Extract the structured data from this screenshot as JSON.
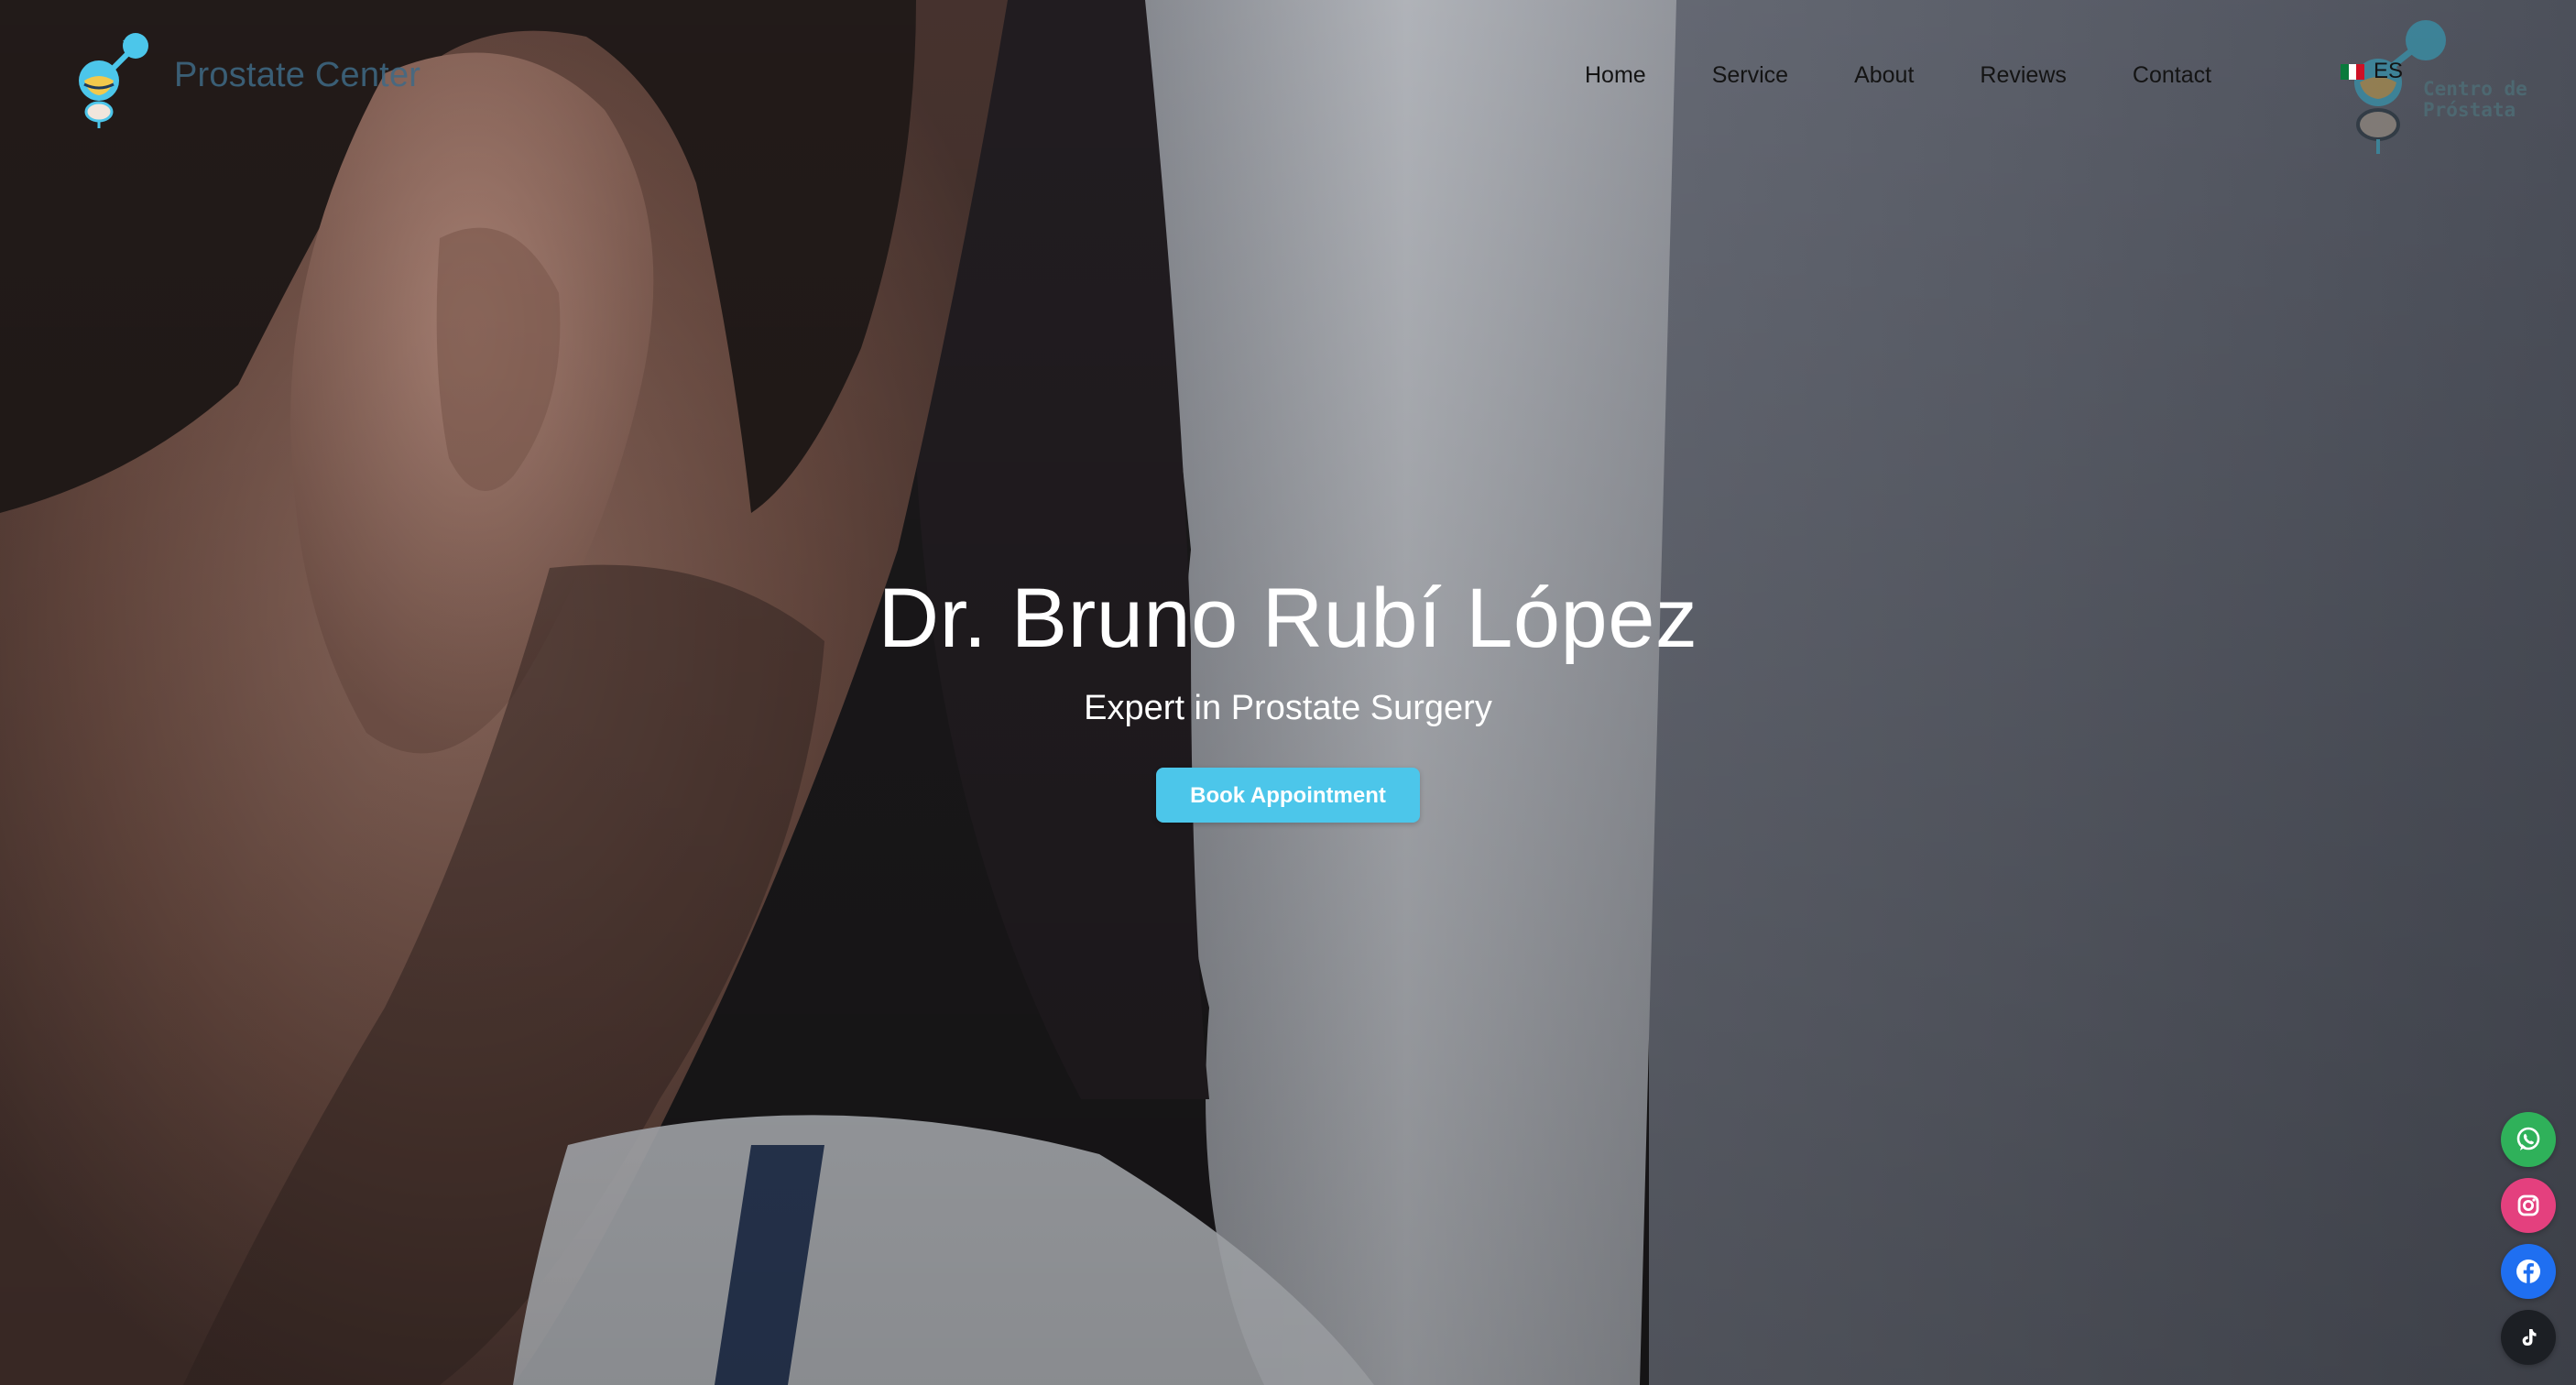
{
  "brand": {
    "name": "Prostate Center"
  },
  "nav": {
    "items": [
      {
        "label": "Home"
      },
      {
        "label": "Service"
      },
      {
        "label": "About"
      },
      {
        "label": "Reviews"
      },
      {
        "label": "Contact"
      }
    ],
    "language": "ES",
    "language_flag": "mexico-flag-icon"
  },
  "partner_logo": {
    "line1": "Centro de",
    "line2": "Próstata"
  },
  "hero": {
    "title": "Dr. Bruno Rubí López",
    "subtitle": "Expert in Prostate Surgery",
    "cta_label": "Book Appointment"
  },
  "social": [
    {
      "icon": "whatsapp-icon",
      "color": "#2fb15a"
    },
    {
      "icon": "instagram-icon",
      "color": "#e4407e"
    },
    {
      "icon": "facebook-icon",
      "color": "#1f6ff1"
    },
    {
      "icon": "tiktok-icon",
      "color": "#1c1f24"
    }
  ],
  "colors": {
    "accent": "#4cc6ea",
    "brand_text": "#3f6a86"
  }
}
